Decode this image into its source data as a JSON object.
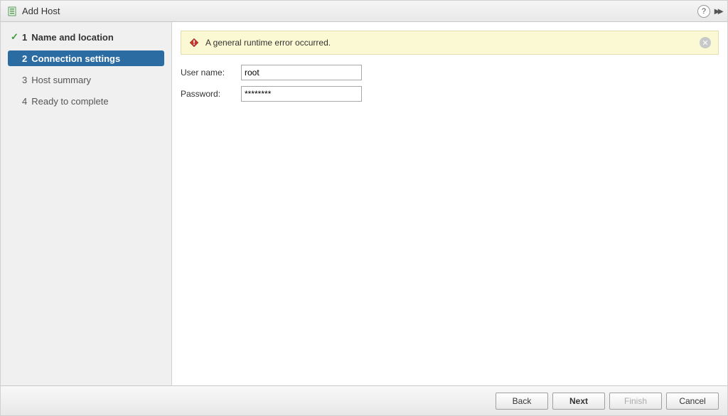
{
  "titlebar": {
    "title": "Add Host"
  },
  "sidebar": {
    "steps": [
      {
        "num": "1",
        "label": "Name and location"
      },
      {
        "num": "2",
        "label": "Connection settings"
      },
      {
        "num": "3",
        "label": "Host summary"
      },
      {
        "num": "4",
        "label": "Ready to complete"
      }
    ]
  },
  "alert": {
    "text": "A general runtime error occurred."
  },
  "form": {
    "username_label": "User name:",
    "username_value": "root",
    "password_label": "Password:",
    "password_value": "********"
  },
  "footer": {
    "back": "Back",
    "next": "Next",
    "finish": "Finish",
    "cancel": "Cancel"
  }
}
